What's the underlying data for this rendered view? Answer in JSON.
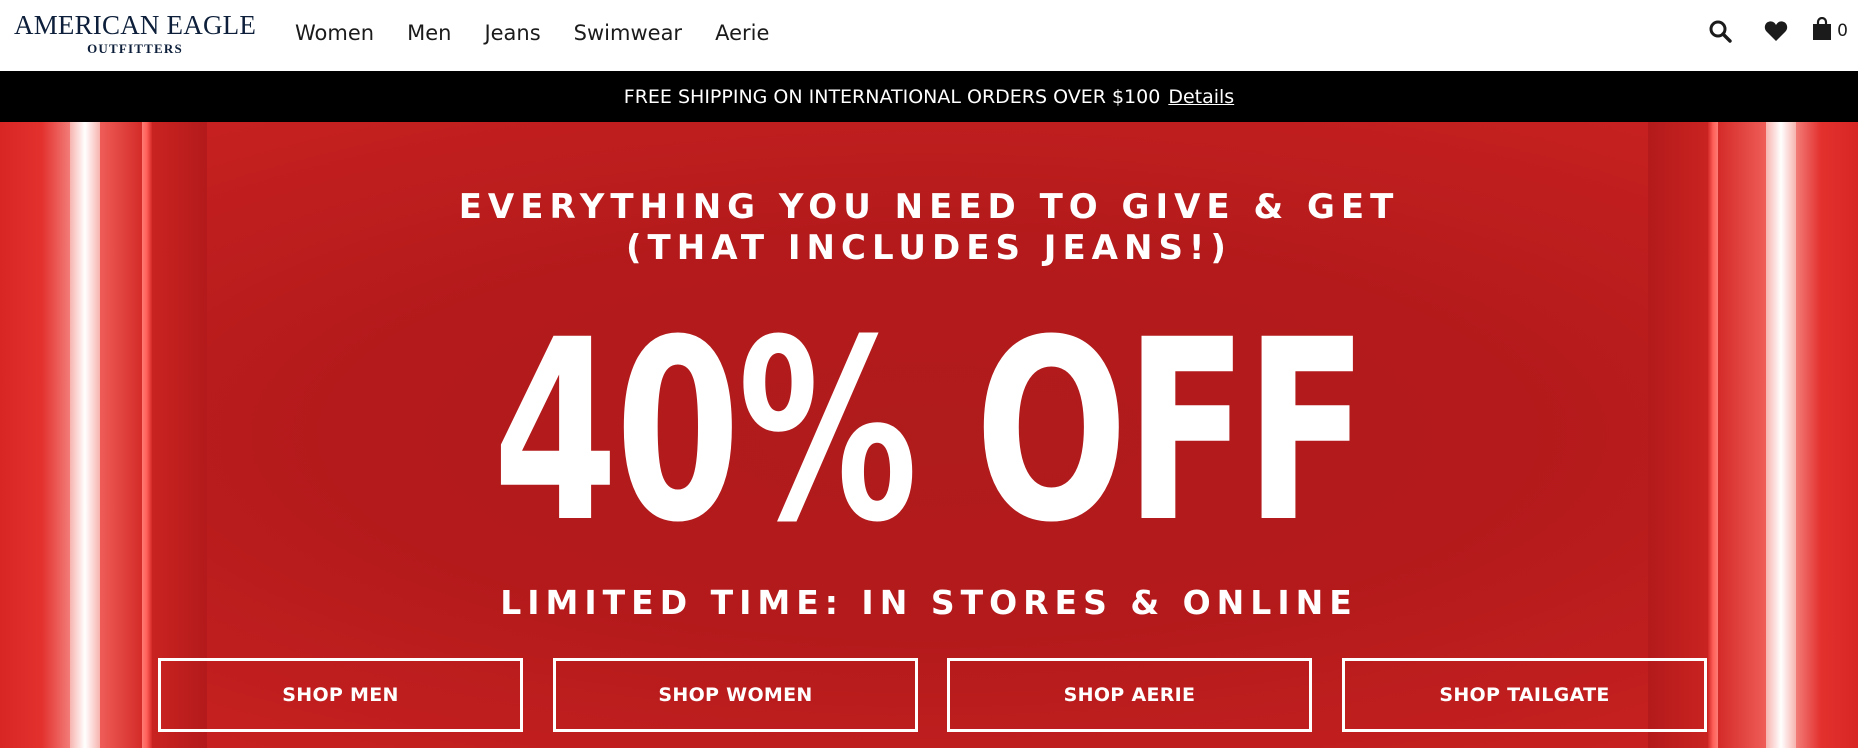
{
  "header": {
    "logo_top": "AMERICAN EAGLE",
    "logo_bottom": "OUTFITTERS",
    "nav": [
      "Women",
      "Men",
      "Jeans",
      "Swimwear",
      "Aerie"
    ],
    "icons": [
      "search-icon",
      "heart-icon",
      "shopping-bag-icon"
    ],
    "cart_count": "0"
  },
  "promo_bar": {
    "text": "FREE SHIPPING ON INTERNATIONAL ORDERS OVER $100",
    "link": "Details"
  },
  "hero": {
    "line1": "EVERYTHING YOU NEED TO GIVE & GET",
    "line2": "(THAT INCLUDES JEANS!)",
    "headline": "40% OFF",
    "line3": "LIMITED TIME: IN STORES & ONLINE",
    "buttons": [
      "SHOP MEN",
      "SHOP WOMEN",
      "SHOP AERIE",
      "SHOP TAILGATE"
    ]
  },
  "colors": {
    "hero_red": "#b41a1b",
    "logo_navy": "#0d1f3a",
    "promo_bg": "#000000"
  }
}
